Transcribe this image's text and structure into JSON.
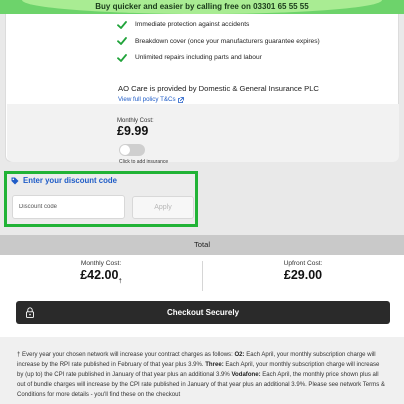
{
  "banner": {
    "text": "Buy quicker and easier by calling free on 03301 65 55 55"
  },
  "care_card": {
    "benefits": [
      "Immediate protection against accidents",
      "Breakdown cover (once your manufacturers guarantee expires)",
      "Unlimited repairs including parts and labour"
    ],
    "provider_text": "AO Care is provided by Domestic & General Insurance PLC",
    "policy_link": "View full policy T&Cs",
    "monthly_cost_label": "Monthly Cost:",
    "monthly_cost_value": "£9.99",
    "toggle_label": "Click to add insurance",
    "toggle_on": false
  },
  "discount": {
    "title": "Enter your discount code",
    "input_placeholder": "Discount code",
    "apply_label": "Apply"
  },
  "total": {
    "heading": "Total",
    "monthly_label": "Monthly Cost:",
    "monthly_value": "£42.00",
    "monthly_marker": "†",
    "upfront_label": "Upfront Cost:",
    "upfront_value": "£29.00"
  },
  "checkout": {
    "label": "Checkout Securely"
  },
  "footnote": {
    "intro": "† Every year your chosen network will increase your contract charges as follows: ",
    "o2_label": "O2:",
    "o2_text": " Each April, your monthly subscription charge will increase by the RPI rate published in February of that year plus 3.9%. ",
    "three_label": "Three:",
    "three_text": " Each April, your monthly subscription charge will increase by (up to) the CPI rate published in January of that year plus an additional 3.9% ",
    "vodafone_label": "Vodafone:",
    "vodafone_text": " Each April, the monthly price shown plus all out of bundle charges will increase by the CPI rate published in January of that year plus an additional 3.9%. Please see network Terms & Conditions for more details - you'll find these on the checkout"
  },
  "colors": {
    "banner_green": "#6dd36b",
    "banner_light_green": "#a9ec93",
    "check_green": "#20a33a",
    "link_blue": "#1f5cc7",
    "highlight_green": "#21b336",
    "checkout_dark": "#2a2a2a"
  }
}
